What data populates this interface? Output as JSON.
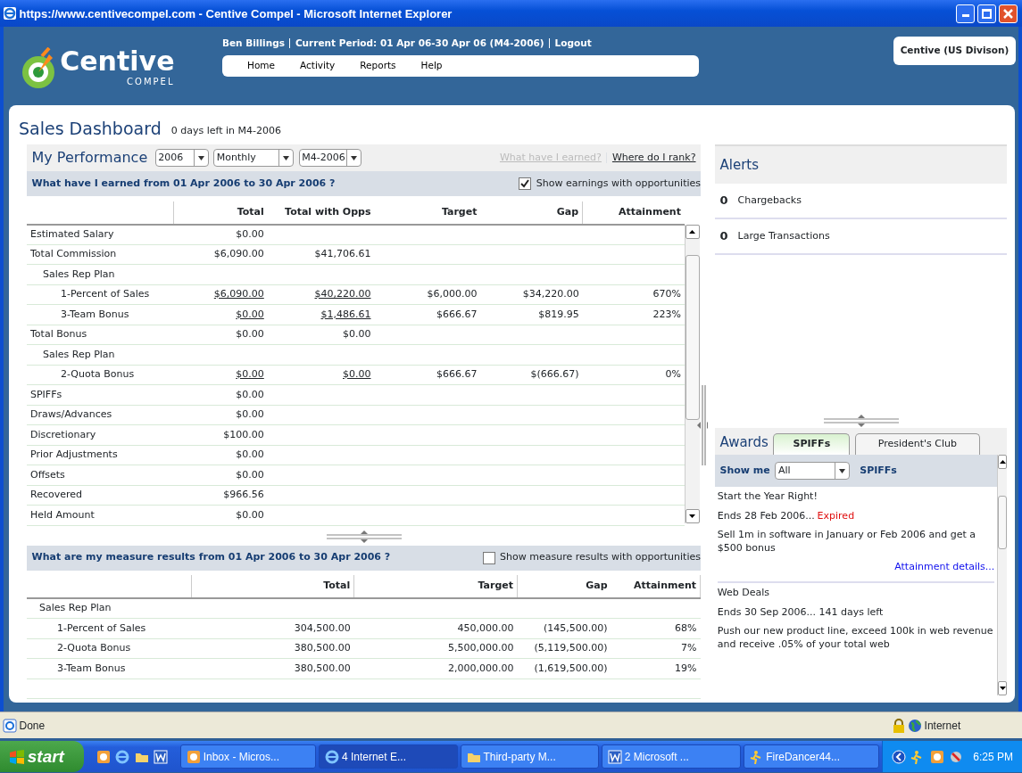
{
  "window": {
    "title": "https://www.centivecompel.com - Centive Compel - Microsoft Internet Explorer"
  },
  "header": {
    "logo": {
      "word": "Centive",
      "sub": "COMPEL"
    },
    "user": "Ben Billings",
    "period": "Current Period: 01 Apr 06-30 Apr 06 (M4-2006)",
    "logout": "Logout",
    "nav": [
      "Home",
      "Activity",
      "Reports",
      "Help"
    ],
    "division": "Centive (US Divison)"
  },
  "page": {
    "title": "Sales Dashboard",
    "subtitle": "0 days left in M4-2006"
  },
  "performance": {
    "title": "My Performance",
    "selects": [
      "2006",
      "Monthly",
      "M4-2006"
    ],
    "links": [
      {
        "label": "What have I earned?",
        "disabled": true
      },
      {
        "label": "Where do I rank?",
        "disabled": false
      }
    ],
    "earnings": {
      "heading": "What have I earned from 01 Apr 2006 to 30 Apr 2006 ?",
      "option": {
        "label": "Show earnings with opportunities",
        "checked": true
      },
      "columns": [
        "Total",
        "Total with Opps",
        "Target",
        "Gap",
        "Attainment"
      ],
      "rows": [
        {
          "label": "Estimated Salary",
          "cells": [
            "$0.00"
          ]
        },
        {
          "label": "Total Commission",
          "cells": [
            "$6,090.00",
            "$41,706.61"
          ],
          "children": [
            {
              "label": "Sales Rep Plan",
              "children": [
                {
                  "label": "1-Percent of Sales",
                  "cells": [
                    "$6,090.00",
                    "$40,220.00",
                    "$6,000.00",
                    "$34,220.00",
                    "670%"
                  ],
                  "linked": true
                },
                {
                  "label": "3-Team Bonus",
                  "cells": [
                    "$0.00",
                    "$1,486.61",
                    "$666.67",
                    "$819.95",
                    "223%"
                  ],
                  "linked": true
                }
              ]
            }
          ]
        },
        {
          "label": "Total Bonus",
          "cells": [
            "$0.00",
            "$0.00"
          ],
          "children": [
            {
              "label": "Sales Rep Plan",
              "children": [
                {
                  "label": "2-Quota Bonus",
                  "cells": [
                    "$0.00",
                    "$0.00",
                    "$666.67",
                    "$(666.67)",
                    "0%"
                  ],
                  "linked": true
                }
              ]
            }
          ]
        },
        {
          "label": "SPIFFs",
          "cells": [
            "$0.00"
          ]
        },
        {
          "label": "Draws/Advances",
          "cells": [
            "$0.00"
          ]
        },
        {
          "label": "Discretionary",
          "cells": [
            "$100.00"
          ]
        },
        {
          "label": "Prior Adjustments",
          "cells": [
            "$0.00"
          ]
        },
        {
          "label": "Offsets",
          "cells": [
            "$0.00"
          ]
        },
        {
          "label": "Recovered",
          "cells": [
            "$966.56"
          ]
        },
        {
          "label": "Held Amount",
          "cells": [
            "$0.00"
          ]
        }
      ]
    },
    "measures": {
      "heading": "What are my measure results from 01 Apr 2006 to 30 Apr 2006 ?",
      "option": {
        "label": "Show measure results with opportunities",
        "checked": false
      },
      "columns": [
        "Total",
        "Target",
        "Gap",
        "Attainment"
      ],
      "rows": [
        {
          "label": "Sales Rep Plan",
          "children": [
            {
              "label": "1-Percent of Sales",
              "cells": [
                "304,500.00",
                "450,000.00",
                "(145,500.00)",
                "68%"
              ]
            },
            {
              "label": "2-Quota Bonus",
              "cells": [
                "380,500.00",
                "5,500,000.00",
                "(5,119,500.00)",
                "7%"
              ]
            },
            {
              "label": "3-Team Bonus",
              "cells": [
                "380,500.00",
                "2,000,000.00",
                "(1,619,500.00)",
                "19%"
              ]
            }
          ]
        }
      ]
    }
  },
  "alerts": {
    "title": "Alerts",
    "items": [
      {
        "count": "0",
        "label": "Chargebacks"
      },
      {
        "count": "0",
        "label": "Large Transactions"
      }
    ]
  },
  "awards": {
    "title": "Awards",
    "tabs": [
      {
        "label": "SPIFFs",
        "selected": true
      },
      {
        "label": "President's Club",
        "selected": false
      }
    ],
    "filter": {
      "label": "Show me",
      "value": "All",
      "suffix": "SPIFFs"
    },
    "items": [
      {
        "title": "Start the Year Right!",
        "ends": "Ends 28 Feb 2006...",
        "status": "Expired",
        "description": "Sell 1m in software in January or Feb 2006 and get a $500 bonus",
        "link": "Attainment details..."
      },
      {
        "title": "Web Deals",
        "ends": "Ends 30 Sep 2006... 141 days left",
        "description": "Push our new product line, exceed 100k in web revenue and receive .05% of your total web"
      }
    ]
  },
  "status_bar": {
    "text": "Done",
    "zone": "Internet"
  },
  "taskbar": {
    "start": "start",
    "tasks": [
      {
        "label": "Inbox - Micros...",
        "selected": false
      },
      {
        "label": "4 Internet E...",
        "selected": true
      },
      {
        "label": "Third-party M...",
        "selected": false
      },
      {
        "label": "2 Microsoft ...",
        "selected": false
      },
      {
        "label": "FireDancer44...",
        "selected": false
      }
    ],
    "clock": "6:25 PM"
  }
}
